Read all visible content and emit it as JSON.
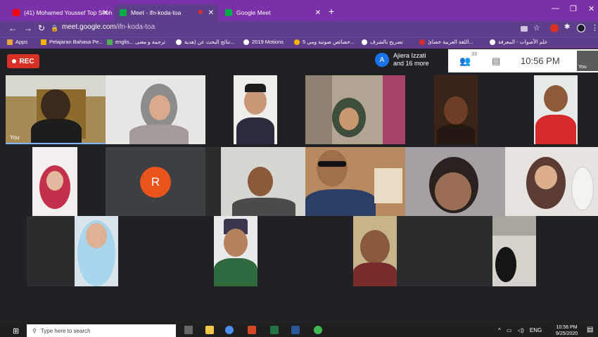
{
  "browser": {
    "tabs": [
      {
        "title": "(41) Mohamed Youssef Top Shoh..",
        "icon": "youtube-icon",
        "active": false
      },
      {
        "title": "Meet - ifn-koda-toa",
        "icon": "meet-icon",
        "active": true
      },
      {
        "title": "Google Meet",
        "icon": "meet-icon",
        "active": false
      }
    ],
    "url_host": "meet.google.com",
    "url_path": "/ifn-koda-toa",
    "bookmarks": [
      "Apps",
      "Pelajaran Bahasa Pe...",
      "englis... ترجمة و معنى",
      "نتائج البحث عن (هدية...",
      "2019 Motions",
      "5 خصائص صوتية ومي...",
      "تصريح بالشرف",
      "اللغة العربية خصائ...",
      "علم الأصوات - المعرفة"
    ]
  },
  "meet": {
    "rec_label": "REC",
    "presenter_initial": "A",
    "presenter_line1": "Ajiera Izzati",
    "presenter_line2": "and 16 more",
    "participant_count": "33",
    "clock": "10:56 PM",
    "self_label": "You",
    "self_name": "You",
    "letter_tile": "R"
  },
  "taskbar": {
    "search_placeholder": "Type here to search",
    "lang": "ENG",
    "time": "10:56 PM",
    "date": "9/25/2020"
  },
  "colors": {
    "accent": "#7b2fa8",
    "rec": "#d93025",
    "letter_avatar": "#e8541b"
  }
}
